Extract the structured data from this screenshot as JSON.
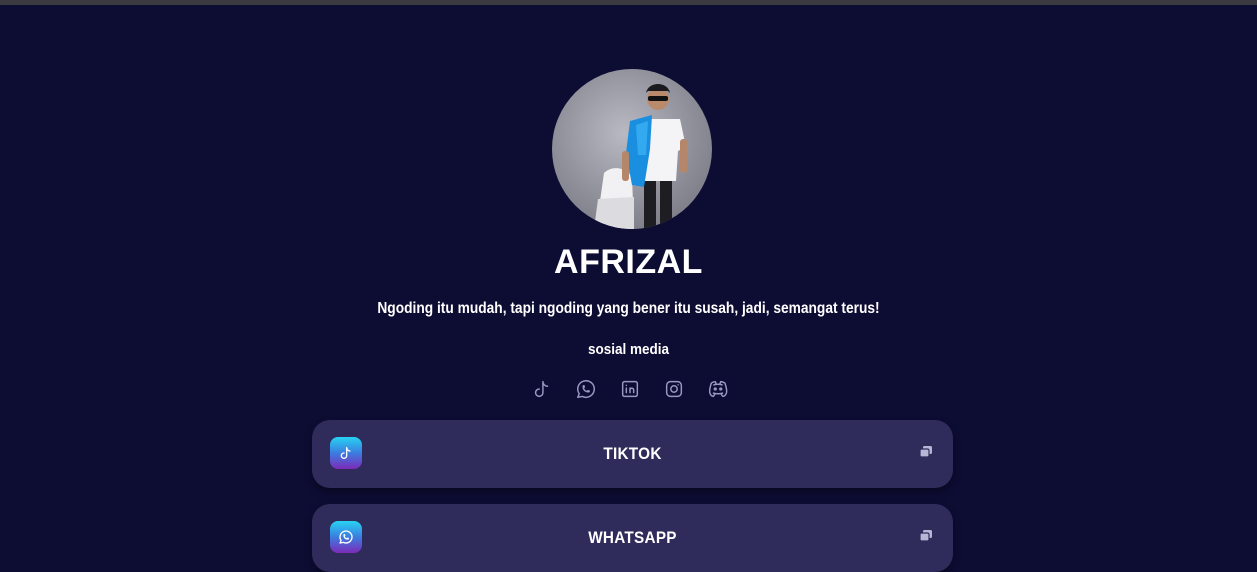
{
  "profile": {
    "name": "AFRIZAL",
    "bio": "Ngoding itu mudah, tapi ngoding yang bener itu susah, jadi, semangat terus!",
    "social_title": "sosial media"
  },
  "social_icons": [
    "tiktok-icon",
    "whatsapp-icon",
    "linkedin-icon",
    "instagram-icon",
    "discord-icon"
  ],
  "links": [
    {
      "label": "TIKTOK",
      "icon": "tiktok-icon"
    },
    {
      "label": "WHATSAPP",
      "icon": "whatsapp-icon"
    }
  ],
  "colors": {
    "background": "#0d0c33",
    "card": "#2f2c5b",
    "icon_gradient_top": "#27d3f2",
    "icon_gradient_bottom": "#7d2ab8",
    "social_icon": "#9a98c2"
  }
}
